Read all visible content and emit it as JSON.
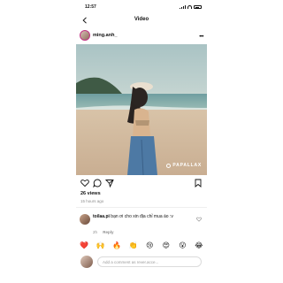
{
  "status_bar": {
    "time": "12:57"
  },
  "nav": {
    "title": "Video"
  },
  "post": {
    "username": "ming.anh_",
    "watermark": "PAPALLAX",
    "views": "26 views",
    "time_ago": "15 hours ago"
  },
  "comment": {
    "username": "toilaa.pi",
    "text": "bạn ơi cho xin địa chỉ mua áo :v",
    "time": "2h",
    "reply_label": "Reply"
  },
  "quick_reactions": [
    "❤️",
    "🙌",
    "🔥",
    "👏",
    "😢",
    "😍",
    "😮",
    "😂"
  ],
  "comment_bar": {
    "placeholder": "Add a comment as rever.acce..."
  },
  "icons": {
    "back": "chevron-left-icon",
    "more": "more-horizontal-icon",
    "like": "heart-icon",
    "comment": "comment-icon",
    "share": "paper-plane-icon",
    "save": "bookmark-icon"
  }
}
